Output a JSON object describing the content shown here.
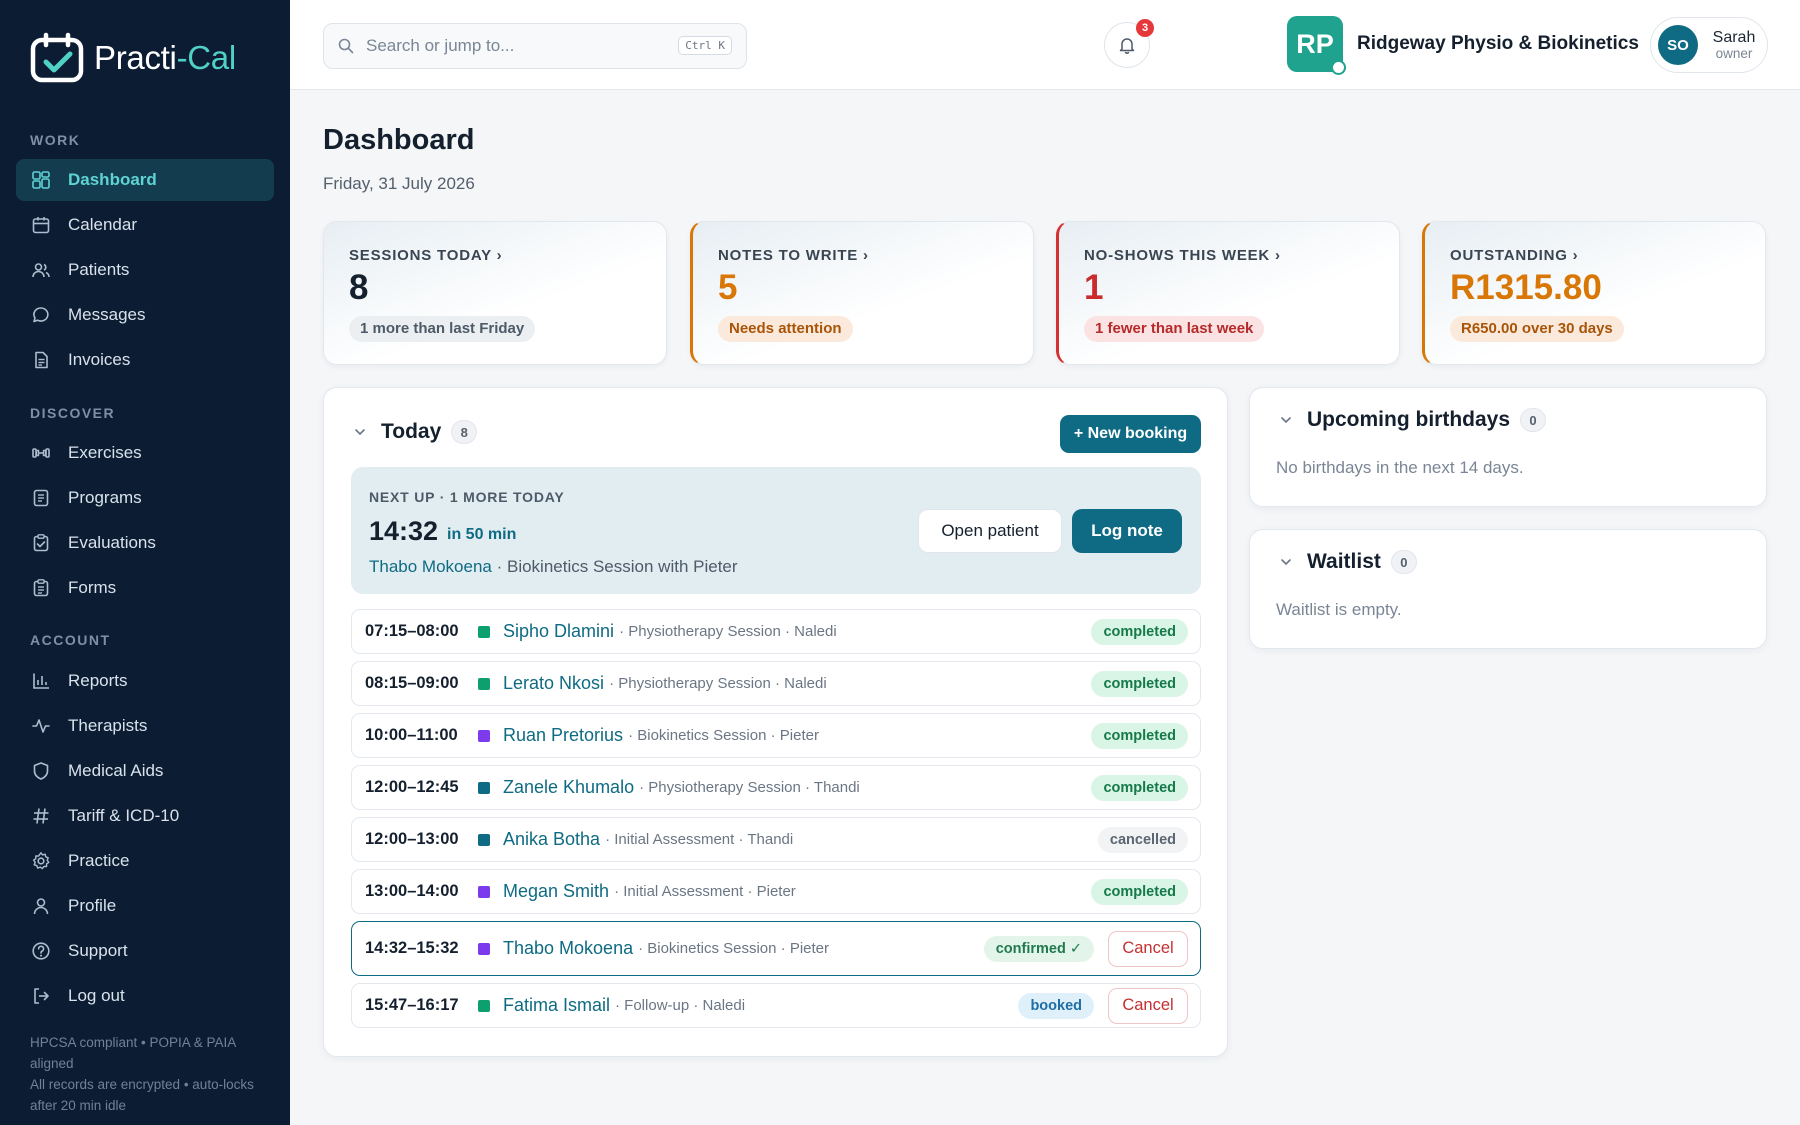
{
  "brand": {
    "name_part1": "Practi",
    "name_part2": "-Cal"
  },
  "sidebar": {
    "sections": [
      "WORK",
      "DISCOVER",
      "ACCOUNT"
    ],
    "work": [
      {
        "label": "Dashboard",
        "icon": "dashboard-icon",
        "active": true
      },
      {
        "label": "Calendar",
        "icon": "calendar-icon"
      },
      {
        "label": "Patients",
        "icon": "users-icon"
      },
      {
        "label": "Messages",
        "icon": "message-icon"
      },
      {
        "label": "Invoices",
        "icon": "invoice-icon"
      }
    ],
    "discover": [
      {
        "label": "Exercises",
        "icon": "dumbbell-icon"
      },
      {
        "label": "Programs",
        "icon": "program-icon"
      },
      {
        "label": "Evaluations",
        "icon": "clipboard-icon"
      },
      {
        "label": "Forms",
        "icon": "form-icon"
      }
    ],
    "account": [
      {
        "label": "Reports",
        "icon": "bar-chart-icon"
      },
      {
        "label": "Therapists",
        "icon": "activity-icon"
      },
      {
        "label": "Medical Aids",
        "icon": "shield-icon"
      },
      {
        "label": "Tariff & ICD-10",
        "icon": "hash-icon"
      },
      {
        "label": "Practice",
        "icon": "gear-icon"
      },
      {
        "label": "Profile",
        "icon": "user-icon"
      },
      {
        "label": "Support",
        "icon": "help-icon"
      },
      {
        "label": "Log out",
        "icon": "logout-icon"
      }
    ],
    "footer_line1": "HPCSA compliant • POPIA & PAIA aligned",
    "footer_line2": "All records are encrypted • auto-locks after 20 min idle"
  },
  "topbar": {
    "search_placeholder": "Search or jump to...",
    "search_shortcut": "Ctrl K",
    "notification_count": "3",
    "practice_initials": "RP",
    "practice_name": "Ridgeway Physio & Biokinetics",
    "user_initials": "SO",
    "user_name": "Sarah",
    "user_role": "owner"
  },
  "page": {
    "title": "Dashboard",
    "date": "Friday, 31 July 2026"
  },
  "stats": [
    {
      "label": "SESSIONS TODAY ›",
      "value": "8",
      "note": "1 more than last Friday",
      "value_color": "#14202e",
      "chip_bg": "#eceff2",
      "chip_color": "#4d5a68"
    },
    {
      "label": "NOTES TO WRITE ›",
      "value": "5",
      "note": "Needs attention",
      "value_color": "#d97706",
      "chip_bg": "#fbeadb",
      "chip_color": "#a8550a"
    },
    {
      "label": "NO-SHOWS THIS WEEK ›",
      "value": "1",
      "note": "1 fewer than last week",
      "value_color": "#c82c2c",
      "chip_bg": "#fbe3e3",
      "chip_color": "#b52a2a"
    },
    {
      "label": "OUTSTANDING ›",
      "value": "R1315.80",
      "note": "R650.00 over 30 days",
      "value_color": "#d97706",
      "chip_bg": "#fbeadb",
      "chip_color": "#a8550a"
    }
  ],
  "today": {
    "title": "Today",
    "count": "8",
    "new_booking": "+ New booking",
    "next_up": {
      "label": "NEXT UP · 1 MORE TODAY",
      "time": "14:32",
      "in": "in 50 min",
      "patient": "Thabo Mokoena",
      "detail": " · Biokinetics Session with Pieter",
      "open_patient": "Open patient",
      "log_note": "Log note"
    },
    "appointments": [
      {
        "time": "07:15–08:00",
        "color": "#0e9f6e",
        "patient": "Sipho Dlamini",
        "meta": "· Physiotherapy Session · Naledi",
        "status": "completed",
        "status_class": "st-completed"
      },
      {
        "time": "08:15–09:00",
        "color": "#0e9f6e",
        "patient": "Lerato Nkosi",
        "meta": "· Physiotherapy Session · Naledi",
        "status": "completed",
        "status_class": "st-completed"
      },
      {
        "time": "10:00–11:00",
        "color": "#7c3aed",
        "patient": "Ruan Pretorius",
        "meta": "· Biokinetics Session · Pieter",
        "status": "completed",
        "status_class": "st-completed"
      },
      {
        "time": "12:00–12:45",
        "color": "#0f6b83",
        "patient": "Zanele Khumalo",
        "meta": "· Physiotherapy Session · Thandi",
        "status": "completed",
        "status_class": "st-completed"
      },
      {
        "time": "12:00–13:00",
        "color": "#0f6b83",
        "patient": "Anika Botha",
        "meta": "· Initial Assessment · Thandi",
        "status": "cancelled",
        "status_class": "st-cancelled"
      },
      {
        "time": "13:00–14:00",
        "color": "#7c3aed",
        "patient": "Megan Smith",
        "meta": "· Initial Assessment · Pieter",
        "status": "completed",
        "status_class": "st-completed"
      },
      {
        "time": "14:32–15:32",
        "color": "#7c3aed",
        "patient": "Thabo Mokoena",
        "meta": "· Biokinetics Session · Pieter",
        "status": "confirmed ✓",
        "status_class": "st-confirmed",
        "cancel": "Cancel"
      },
      {
        "time": "15:47–16:17",
        "color": "#0e9f6e",
        "patient": "Fatima Ismail",
        "meta": "· Follow-up · Naledi",
        "status": "booked",
        "status_class": "st-booked",
        "cancel": "Cancel"
      }
    ]
  },
  "birthdays": {
    "title": "Upcoming birthdays",
    "count": "0",
    "empty": "No birthdays in the next 14 days."
  },
  "waitlist": {
    "title": "Waitlist",
    "count": "0",
    "empty": "Waitlist is empty."
  }
}
